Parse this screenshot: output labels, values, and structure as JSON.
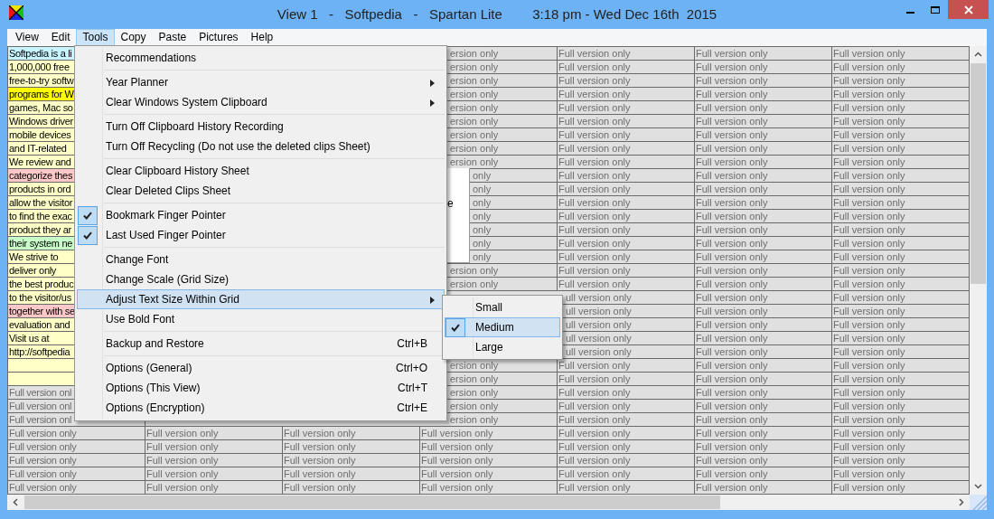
{
  "window": {
    "title": "View 1   -   Softpedia   -   Spartan Lite        3:18 pm - Wed Dec 16th  2015"
  },
  "menu_bar": [
    {
      "label": "View",
      "selected": false
    },
    {
      "label": "Edit",
      "selected": false
    },
    {
      "label": "Tools",
      "selected": true
    },
    {
      "label": "Copy",
      "selected": false
    },
    {
      "label": "Paste",
      "selected": false
    },
    {
      "label": "Pictures",
      "selected": false
    },
    {
      "label": "Help",
      "selected": false
    }
  ],
  "tools_menu": {
    "groups": [
      [
        {
          "label": "Recommendations",
          "checked": false,
          "submenu": false,
          "selected": false
        }
      ],
      [
        {
          "label": "Year Planner",
          "checked": false,
          "submenu": true,
          "selected": false
        },
        {
          "label": "Clear Windows System Clipboard",
          "checked": false,
          "submenu": true,
          "selected": false
        }
      ],
      [
        {
          "label": "Turn Off Clipboard History Recording",
          "checked": false,
          "submenu": false,
          "selected": false
        },
        {
          "label": "Turn Off Recycling (Do not use the deleted clips Sheet)",
          "checked": false,
          "submenu": false,
          "selected": false
        }
      ],
      [
        {
          "label": "Clear Clipboard History Sheet",
          "checked": false,
          "submenu": false,
          "selected": false
        },
        {
          "label": "Clear Deleted Clips Sheet",
          "checked": false,
          "submenu": false,
          "selected": false
        }
      ],
      [
        {
          "label": "Bookmark Finger Pointer",
          "checked": true,
          "submenu": false,
          "selected": false
        },
        {
          "label": "Last Used Finger Pointer",
          "checked": true,
          "submenu": false,
          "selected": false
        }
      ],
      [
        {
          "label": "Change Font",
          "checked": false,
          "submenu": false,
          "selected": false
        },
        {
          "label": "Change Scale (Grid Size)",
          "checked": false,
          "submenu": false,
          "selected": false
        },
        {
          "label": "Adjust Text Size Within Grid",
          "checked": false,
          "submenu": true,
          "selected": true
        },
        {
          "label": "Use Bold Font",
          "checked": false,
          "submenu": false,
          "selected": false
        }
      ],
      [
        {
          "label": "Backup and Restore",
          "shortcut": "Ctrl+B",
          "checked": false,
          "submenu": false,
          "selected": false
        }
      ],
      [
        {
          "label": "Options (General)",
          "shortcut": "Ctrl+O",
          "checked": false,
          "submenu": false,
          "selected": false
        },
        {
          "label": "Options (This View)",
          "shortcut": "Ctrl+T",
          "checked": false,
          "submenu": false,
          "selected": false
        },
        {
          "label": "Options (Encryption)",
          "shortcut": "Ctrl+E",
          "checked": false,
          "submenu": false,
          "selected": false
        }
      ]
    ]
  },
  "text_size_submenu": {
    "items": [
      {
        "label": "Small",
        "checked": false,
        "selected": false
      },
      {
        "label": "Medium",
        "checked": true,
        "selected": true
      },
      {
        "label": "Large",
        "checked": false,
        "selected": false
      }
    ]
  },
  "hidden_popup": {
    "text": "e"
  },
  "grid": {
    "rows": [
      {
        "kind": "clip",
        "color": "#c8f4ff",
        "cells": [
          "Softpedia is a li",
          null,
          null,
          "ersion only",
          "Full version only",
          "Full version only",
          "Full version only"
        ]
      },
      {
        "kind": "clip",
        "color": "#ffffc8",
        "cells": [
          "1,000,000 free",
          null,
          null,
          "ersion only",
          "Full version only",
          "Full version only",
          "Full version only"
        ]
      },
      {
        "kind": "clip",
        "color": "#ffffc8",
        "cells": [
          "free-to-try softw",
          null,
          null,
          "ersion only",
          "Full version only",
          "Full version only",
          "Full version only"
        ]
      },
      {
        "kind": "clip",
        "color": "#ffff00",
        "cells": [
          "programs for W",
          null,
          null,
          "ersion only",
          "Full version only",
          "Full version only",
          "Full version only"
        ]
      },
      {
        "kind": "clip",
        "color": "#ffffc8",
        "cells": [
          "games, Mac so",
          null,
          null,
          "ersion only",
          "Full version only",
          "Full version only",
          "Full version only"
        ]
      },
      {
        "kind": "clip",
        "color": "#ffffc8",
        "cells": [
          "Windows driver",
          null,
          null,
          "ersion only",
          "Full version only",
          "Full version only",
          "Full version only"
        ]
      },
      {
        "kind": "clip",
        "color": "#ffffc8",
        "cells": [
          "mobile devices",
          null,
          null,
          "ersion only",
          "Full version only",
          "Full version only",
          "Full version only"
        ]
      },
      {
        "kind": "clip",
        "color": "#ffffc8",
        "cells": [
          "and IT-related",
          null,
          null,
          "ersion only",
          "Full version only",
          "Full version only",
          "Full version only"
        ]
      },
      {
        "kind": "clip",
        "color": "#ffffc8",
        "cells": [
          "We review and",
          null,
          null,
          "ersion only",
          "Full version only",
          "Full version only",
          "Full version only"
        ]
      },
      {
        "kind": "clip",
        "color": "#ffc8c8",
        "cells": [
          "categorize thes",
          null,
          null,
          "only",
          "Full version only",
          "Full version only",
          "Full version only"
        ]
      },
      {
        "kind": "clip",
        "color": "#ffffc8",
        "cells": [
          "products in ord",
          null,
          null,
          "only",
          "Full version only",
          "Full version only",
          "Full version only"
        ]
      },
      {
        "kind": "clip",
        "color": "#ffffc8",
        "cells": [
          "allow the visitor",
          null,
          null,
          "only",
          "Full version only",
          "Full version only",
          "Full version only"
        ]
      },
      {
        "kind": "clip",
        "color": "#ffffc8",
        "cells": [
          "to find the exac",
          null,
          null,
          "only",
          "Full version only",
          "Full version only",
          "Full version only"
        ]
      },
      {
        "kind": "clip",
        "color": "#ffffc8",
        "cells": [
          "product they ar",
          null,
          null,
          "only",
          "Full version only",
          "Full version only",
          "Full version only"
        ]
      },
      {
        "kind": "clip",
        "color": "#c8ffc8",
        "cells": [
          "their system ne",
          null,
          null,
          "only",
          "Full version only",
          "Full version only",
          "Full version only"
        ]
      },
      {
        "kind": "clip",
        "color": "#ffffc8",
        "cells": [
          "We strive to",
          null,
          null,
          "only",
          "Full version only",
          "Full version only",
          "Full version only"
        ]
      },
      {
        "kind": "clip",
        "color": "#ffffc8",
        "cells": [
          "deliver only",
          null,
          null,
          "ersion only",
          "Full version only",
          "Full version only",
          "Full version only"
        ]
      },
      {
        "kind": "clip",
        "color": "#ffffc8",
        "cells": [
          "the best produc",
          null,
          null,
          "ersion only",
          "Full version only",
          "Full version only",
          "Full version only"
        ]
      },
      {
        "kind": "clip",
        "color": "#ffffc8",
        "cells": [
          "to the visitor/us",
          null,
          null,
          null,
          "ull version only",
          "Full version only",
          "Full version only"
        ]
      },
      {
        "kind": "clip",
        "color": "#ffc8c8",
        "cells": [
          "together with se",
          null,
          null,
          null,
          "ull version only",
          "Full version only",
          "Full version only"
        ]
      },
      {
        "kind": "clip",
        "color": "#ffffc8",
        "cells": [
          "evaluation and",
          null,
          null,
          null,
          "ull version only",
          "Full version only",
          "Full version only"
        ]
      },
      {
        "kind": "clip",
        "color": "#ffffc8",
        "cells": [
          "Visit us at",
          null,
          null,
          null,
          "ull version only",
          "Full version only",
          "Full version only"
        ]
      },
      {
        "kind": "clip",
        "color": "#ffffc8",
        "cells": [
          "http://softpedia",
          null,
          null,
          null,
          "ull version only",
          "Full version only",
          "Full version only"
        ]
      },
      {
        "kind": "clip",
        "color": "#ffffc8",
        "cells": [
          null,
          null,
          null,
          "ersion only",
          "Full version only",
          "Full version only",
          "Full version only"
        ]
      },
      {
        "kind": "clip",
        "color": "#ffffc8",
        "cells": [
          null,
          null,
          null,
          "ersion only",
          "Full version only",
          "Full version only",
          "Full version only"
        ]
      },
      {
        "kind": "locked",
        "cells": [
          "Full version onl",
          null,
          null,
          "ersion only",
          "Full version only",
          "Full version only",
          "Full version only"
        ]
      },
      {
        "kind": "locked",
        "cells": [
          "Full version onl",
          null,
          null,
          "ersion only",
          "Full version only",
          "Full version only",
          "Full version only"
        ]
      },
      {
        "kind": "locked",
        "cells": [
          "Full version onl",
          null,
          null,
          "ersion only",
          "Full version only",
          "Full version only",
          "Full version only"
        ]
      },
      {
        "kind": "locked",
        "cells": [
          "Full version only",
          "Full version only",
          "Full version only",
          "Full version only",
          "Full version only",
          "Full version only",
          "Full version only"
        ]
      },
      {
        "kind": "locked",
        "cells": [
          "Full version only",
          "Full version only",
          "Full version only",
          "Full version only",
          "Full version only",
          "Full version only",
          "Full version only"
        ]
      },
      {
        "kind": "locked",
        "cells": [
          "Full version only",
          "Full version only",
          "Full version only",
          "Full version only",
          "Full version only",
          "Full version only",
          "Full version only"
        ]
      },
      {
        "kind": "locked",
        "cells": [
          "Full version only",
          "Full version only",
          "Full version only",
          "Full version only",
          "Full version only",
          "Full version only",
          "Full version only"
        ]
      },
      {
        "kind": "locked",
        "cells": [
          "Full version only",
          "Full version only",
          "Full version only",
          "Full version only",
          "Full version only",
          "Full version only",
          "Full version only"
        ]
      }
    ]
  }
}
